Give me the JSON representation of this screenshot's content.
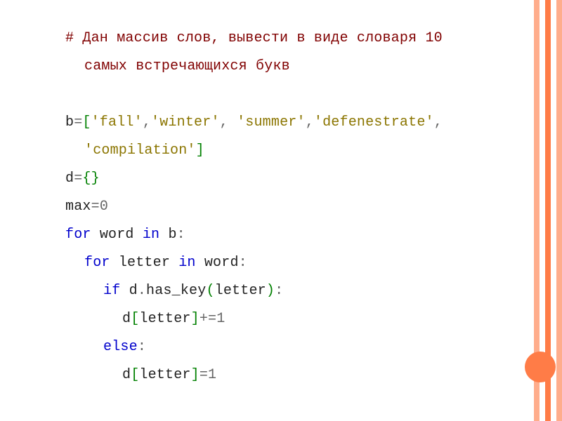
{
  "code": {
    "comment1": "# Дан массив слов, вывести в виде словаря 10",
    "comment2": "самых встречающихся букв",
    "l1_var": "b",
    "l1_eq": "=",
    "l1_lb": "[",
    "l1_s1": "'fall'",
    "l1_c1": ",",
    "l1_s2": "'winter'",
    "l1_c2": ",",
    "l1_sp": " ",
    "l1_s3": "'summer'",
    "l1_c3": ",",
    "l1_s4": "'defenestrate'",
    "l1_c4": ",",
    "l1b_s5": "'compilation'",
    "l1b_rb": "]",
    "l2_var": "d",
    "l2_eq": "=",
    "l2_lb": "{}",
    "l3_var": "max",
    "l3_eq": "=",
    "l3_num": "0",
    "l4_for": "for",
    "l4_sp1": " ",
    "l4_word": "word",
    "l4_sp2": " ",
    "l4_in": "in",
    "l4_sp3": " ",
    "l4_b": "b",
    "l4_colon": ":",
    "l5_for": "for",
    "l5_sp1": " ",
    "l5_letter": "letter",
    "l5_sp2": " ",
    "l5_in": "in",
    "l5_sp3": " ",
    "l5_word": "word",
    "l5_colon": ":",
    "l6_if": "if",
    "l6_sp1": " ",
    "l6_d": "d",
    "l6_dot": ".",
    "l6_has": "has_key",
    "l6_lp": "(",
    "l6_letter": "letter",
    "l6_rp": ")",
    "l6_colon": ":",
    "l7_d": "d",
    "l7_lb": "[",
    "l7_letter": "letter",
    "l7_rb": "]",
    "l7_op": "+=",
    "l7_num": "1",
    "l8_else": "else",
    "l8_colon": ":",
    "l9_d": "d",
    "l9_lb": "[",
    "l9_letter": "letter",
    "l9_rb": "]",
    "l9_op": "=",
    "l9_num": "1"
  }
}
